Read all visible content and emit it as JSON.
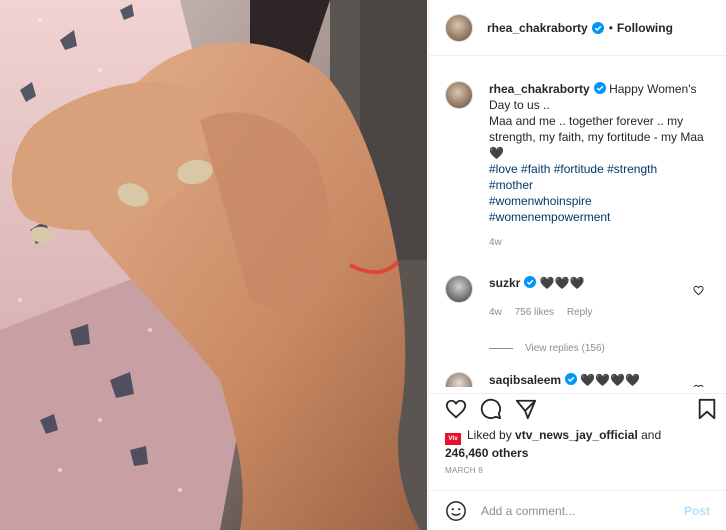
{
  "header": {
    "username": "rhea_chakraborty",
    "separator": "•",
    "follow_status": "Following"
  },
  "caption": {
    "username": "rhea_chakraborty",
    "line1": "Happy Women's Day to us ..",
    "line2": "Maa and me .. together forever .. my strength, my faith, my fortitude - my Maa",
    "heart": "🖤",
    "hashtags": [
      "#love",
      "#faith",
      "#fortitude",
      "#strength",
      "#mother",
      "#womenwhoinspire",
      "#womenempowerment"
    ],
    "age": "4w"
  },
  "comments": [
    {
      "username": "suzkr",
      "text": "🖤🖤🖤",
      "age": "4w",
      "likes": "756 likes",
      "reply": "Reply",
      "view_replies": "View replies (156)"
    },
    {
      "username": "saqibsaleem",
      "text": "🖤🖤🖤🖤"
    }
  ],
  "likes": {
    "badge_text": "Vtv",
    "prefix": "Liked by",
    "user": "vtv_news_jay_official",
    "middle": "and",
    "others": "246,460 others"
  },
  "date": "MARCH 8",
  "add_comment": {
    "placeholder": "Add a comment...",
    "post_label": "Post"
  },
  "icons": [
    "verified-badge-icon",
    "heart-icon",
    "comment-icon",
    "share-icon",
    "bookmark-icon",
    "emoji-icon"
  ],
  "colors": {
    "verified": "#0095f6",
    "link": "#00376b",
    "post_disabled": "#b2dffc",
    "muted": "#8e8e8e"
  }
}
